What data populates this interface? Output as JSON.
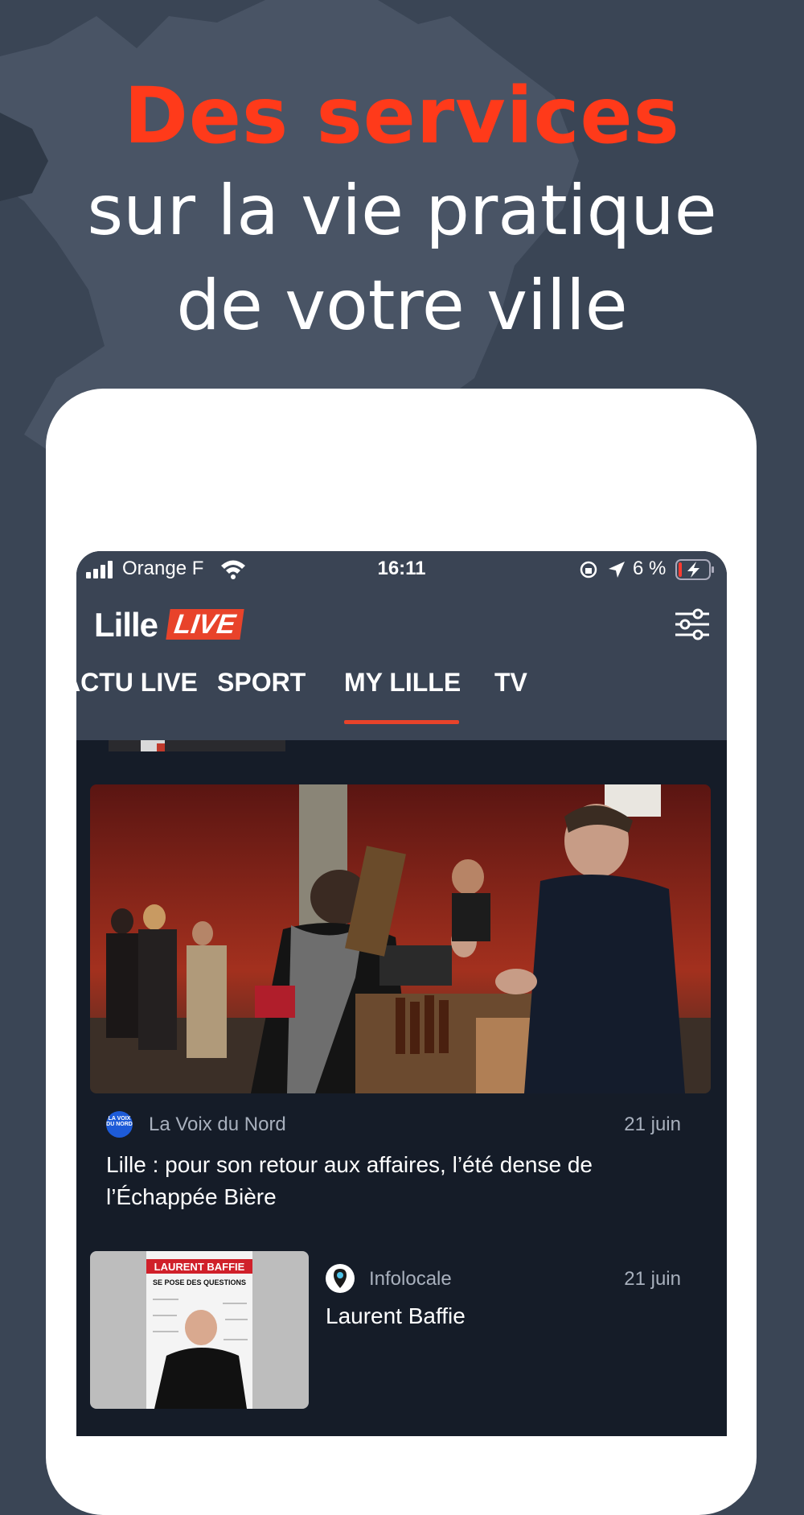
{
  "promo": {
    "headline_accent": "Des services",
    "headline_line_2": "sur la vie pratique",
    "headline_line_3": "de votre ville"
  },
  "status_bar": {
    "carrier": "Orange F",
    "time": "16:11",
    "battery": "6 %"
  },
  "app": {
    "logo_text": "Lille",
    "logo_badge": "LIVE"
  },
  "tabs": [
    {
      "label": "ACTU LIVE"
    },
    {
      "label": "SPORT"
    },
    {
      "label": "MY LILLE",
      "active": true
    },
    {
      "label": "TV"
    }
  ],
  "articles": [
    {
      "source": "La Voix du Nord",
      "source_logo_text": "LA VOIX DU NORD",
      "date": "21 juin",
      "title": "Lille : pour son retour aux affaires, l’été dense de l’Échappée Bière"
    },
    {
      "source": "Infolocale",
      "date": "21 juin",
      "title": "Laurent Baffie",
      "thumb_poster_title": "LAURENT BAFFIE",
      "thumb_poster_subtitle": "SE POSE DES QUESTIONS"
    }
  ],
  "colors": {
    "background": "#3a4555",
    "accent": "#ff3a1a",
    "header": "#3a4454",
    "feed": "#151c28",
    "tab_indicator": "#e8432a"
  },
  "icons": [
    "signal-icon",
    "wifi-icon",
    "orientation-lock-icon",
    "location-arrow-icon",
    "battery-charging-icon",
    "filter-settings-icon"
  ]
}
